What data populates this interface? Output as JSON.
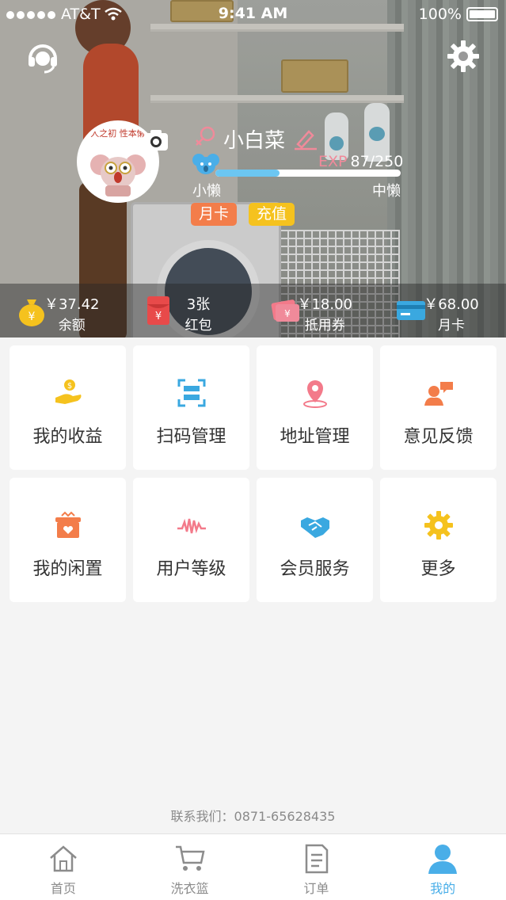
{
  "status_bar": {
    "carrier": "AT&T",
    "time": "9:41 AM",
    "battery": "100%"
  },
  "profile": {
    "avatar_text": "人之初 性本懒",
    "name": "小白菜",
    "exp_label": "EXP",
    "exp_value": "87/250",
    "exp_progress": 0.348,
    "level_current": "小懒",
    "level_next": "中懒",
    "tags": [
      "月卡",
      "充值"
    ]
  },
  "stats": [
    {
      "value": "￥37.42",
      "label": "余额",
      "icon": "money-bag-icon"
    },
    {
      "value": "3张",
      "label": "红包",
      "icon": "red-envelope-icon"
    },
    {
      "value": "￥18.00",
      "label": "抵用券",
      "icon": "ticket-icon"
    },
    {
      "value": "￥68.00",
      "label": "月卡",
      "icon": "card-icon"
    }
  ],
  "menu": [
    {
      "label": "我的收益",
      "icon": "hand-coin-icon"
    },
    {
      "label": "扫码管理",
      "icon": "scan-icon"
    },
    {
      "label": "地址管理",
      "icon": "location-pin-icon"
    },
    {
      "label": "意见反馈",
      "icon": "feedback-icon"
    },
    {
      "label": "我的闲置",
      "icon": "basket-heart-icon"
    },
    {
      "label": "用户等级",
      "icon": "wave-icon"
    },
    {
      "label": "会员服务",
      "icon": "handshake-icon"
    },
    {
      "label": "更多",
      "icon": "gear-icon"
    }
  ],
  "contact": "联系我们：0871-65628435",
  "tabs": [
    {
      "label": "首页",
      "icon": "home-icon"
    },
    {
      "label": "洗衣篮",
      "icon": "cart-icon"
    },
    {
      "label": "订单",
      "icon": "order-icon"
    },
    {
      "label": "我的",
      "icon": "user-icon"
    }
  ],
  "colors": {
    "accent": "#49aee8",
    "orange": "#f37d4a",
    "yellow": "#f5c21e",
    "red": "#e84a4a"
  }
}
